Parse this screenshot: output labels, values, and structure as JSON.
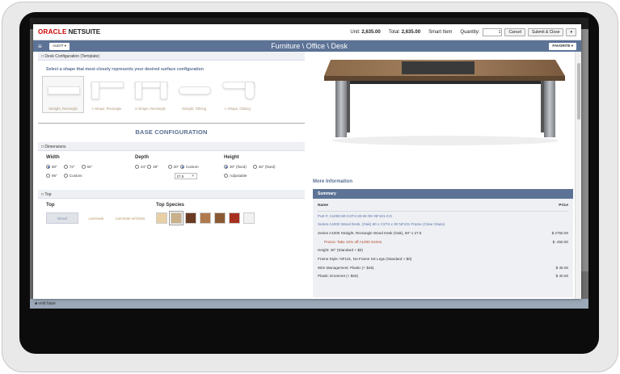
{
  "header": {
    "logo_oracle": "ORACLE",
    "logo_netsuite": "NETSUITE",
    "unit_label": "Unit:",
    "unit_value": "2,635.00",
    "total_label": "Total:",
    "total_value": "2,635.00",
    "smart_item": "Smart Item",
    "quantity_label": "Quantity:",
    "quantity_value": "1",
    "cancel_label": "Cancel",
    "submit_label": "Submit & Close"
  },
  "titlebar": {
    "audit_label": "AUDIT ▾",
    "title": "Furniture \\ Office \\ Desk",
    "favorite_label": "FAVORITE ▾"
  },
  "desk_config": {
    "section_title": "Desk Configuration (Template)",
    "prompt": "Select a shape that most closely represents your desired surface configuration",
    "shapes": [
      {
        "label": "Straight, Rectangle",
        "selected": true
      },
      {
        "label": "L-Shape, Rectangle",
        "selected": false
      },
      {
        "label": "U-Shape, Rectangle",
        "selected": false
      },
      {
        "label": "Straight, Oblong",
        "selected": false
      },
      {
        "label": "L-Shape, Oblong",
        "selected": false
      }
    ]
  },
  "base_title": "BASE CONFIGURATION",
  "dimensions": {
    "section_title": "Dimensions",
    "width": {
      "title": "Width",
      "options": [
        "60\"",
        "72\"",
        "84\"",
        "96\"",
        "Custom"
      ],
      "selected": "60\""
    },
    "depth": {
      "title": "Depth",
      "options": [
        "24\"",
        "30\"",
        "36\"",
        "Custom"
      ],
      "selected": "Custom",
      "custom_value": "27.5"
    },
    "height": {
      "title": "Height",
      "options": [
        "30\" (fixed)",
        "36\" (fixed)",
        "Adjustable"
      ],
      "selected": "30\" (fixed)"
    }
  },
  "top": {
    "section_title": "Top",
    "top_title": "Top",
    "options": [
      "Wood",
      "Laminate",
      "Laminate w/Glass"
    ],
    "selected": "Wood",
    "species_title": "Top Species",
    "swatches": [
      "#e8cfa6",
      "#c9b08a",
      "#6b3a22",
      "#b07a4e",
      "#8a5a34",
      "#a8301e",
      "#f2f2f2"
    ]
  },
  "more_info": "More Information",
  "summary": {
    "title": "Summary",
    "col_name": "Name",
    "col_price": "Price",
    "lines": [
      {
        "desc": "Part #: A1000-60-CST4-30-W-OK-NF101-CG",
        "amt": "",
        "style": "blue"
      },
      {
        "desc": "Series A1000 Wood Desk, (Oak) 60 x CST4 x 30 NF101 Frame (Clear Glass)",
        "amt": "",
        "style": "blue"
      },
      {
        "desc": "Series A1000 Straight, Rectangle Wood Desk (Oak), 60\" x 27.5",
        "amt": "$ 2750.00",
        "style": ""
      },
      {
        "desc": "Promo: Take 10% off A1000 Series",
        "amt": "$ -250.00",
        "style": "promo"
      },
      {
        "desc": "Height: 30\" (Standard + $0)",
        "amt": "",
        "style": ""
      },
      {
        "desc": "Frame Style: NF101, No-Frame SS Legs (Standard + $0)",
        "amt": "",
        "style": ""
      },
      {
        "desc": "Wire Management: Plastic (+ $45)",
        "amt": "$ 45.00",
        "style": ""
      },
      {
        "desc": "Plastic Grommet (+ $40)",
        "amt": "$ 40.00",
        "style": ""
      }
    ]
  },
  "bg_footer": "■ void base"
}
